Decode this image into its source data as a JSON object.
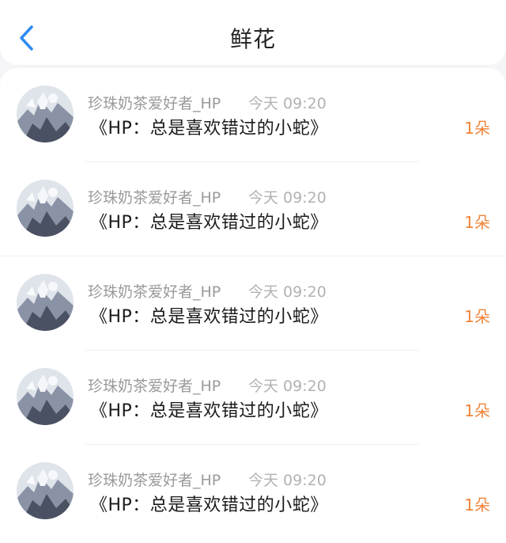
{
  "header": {
    "title": "鲜花",
    "back_icon": "chevron-left-icon",
    "accent_color": "#2f8bf0"
  },
  "flowers": [
    {
      "user": "珍珠奶茶爱好者_HP",
      "time": "今天 09:20",
      "book": "《HP：总是喜欢错过的小蛇》",
      "count": "1朵"
    },
    {
      "user": "珍珠奶茶爱好者_HP",
      "time": "今天 09:20",
      "book": "《HP：总是喜欢错过的小蛇》",
      "count": "1朵"
    },
    {
      "user": "珍珠奶茶爱好者_HP",
      "time": "今天 09:20",
      "book": "《HP：总是喜欢错过的小蛇》",
      "count": "1朵"
    },
    {
      "user": "珍珠奶茶爱好者_HP",
      "time": "今天 09:20",
      "book": "《HP：总是喜欢错过的小蛇》",
      "count": "1朵"
    },
    {
      "user": "珍珠奶茶爱好者_HP",
      "time": "今天 09:20",
      "book": "《HP：总是喜欢错过的小蛇》",
      "count": "1朵"
    }
  ]
}
